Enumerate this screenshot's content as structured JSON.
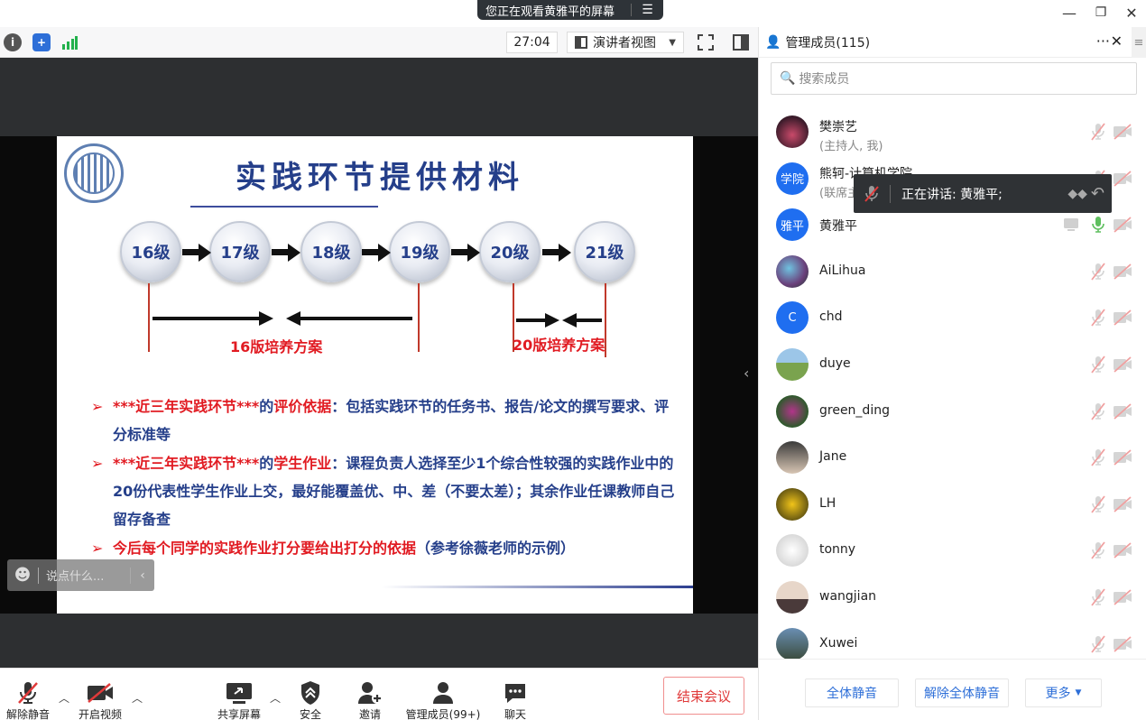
{
  "window": {
    "share_banner": "您正在观看黄雅平的屏幕",
    "banner_menu": "☰",
    "minimize": "—",
    "restore": "❐",
    "close": "✕"
  },
  "toolbar": {
    "timer": "27:04",
    "view_mode": "演讲者视图"
  },
  "slide": {
    "title": "实践环节提供材料",
    "grades": [
      "16级",
      "17级",
      "18级",
      "19级",
      "20级",
      "21级"
    ],
    "plan16": "16版培养方案",
    "plan20": "20版培养方案",
    "bullet1_red": "***近三年实践环节***",
    "bullet1_black": "的",
    "bullet1_red2": "评价依据",
    "bullet1_rest": "：包括实践环节的任务书、报告/论文的撰写要求、评分标准等",
    "bullet2_red": "***近三年实践环节***",
    "bullet2_black": "的",
    "bullet2_red2": "学生作业",
    "bullet2_rest": "：课程负责人选择至少1个综合性较强的实践作业中的20份代表性学生作业上交，最好能覆盖优、中、差（不要太差）；其余作业任课教师自己留存备查",
    "bullet3_red": "今后每个同学的实践作业打分要给出打分的依据",
    "bullet3_rest": "（参考徐薇老师的示例）"
  },
  "chat": {
    "placeholder": "说点什么..."
  },
  "bottom": {
    "unmute": "解除静音",
    "video": "开启视频",
    "share": "共享屏幕",
    "security": "安全",
    "invite": "邀请",
    "manage": "管理成员(99+)",
    "chat": "聊天",
    "end": "结束会议"
  },
  "panel": {
    "title": "管理成员(115)",
    "more": "···",
    "close": "✕",
    "search_placeholder": "搜索成员",
    "speaking": "正在讲话: 黄雅平;",
    "members": [
      {
        "name": "樊崇艺",
        "sub": "(主持人, 我)"
      },
      {
        "name": "熊轲-计算机学院",
        "sub": "(联席主",
        "avatar_text": "学院"
      },
      {
        "name": "黄雅平",
        "avatar_text": "雅平"
      },
      {
        "name": "AiLihua"
      },
      {
        "name": "chd",
        "avatar_text": "C"
      },
      {
        "name": "duye"
      },
      {
        "name": "green_ding"
      },
      {
        "name": "Jane"
      },
      {
        "name": "LH"
      },
      {
        "name": "tonny"
      },
      {
        "name": "wangjian"
      },
      {
        "name": "Xuwei"
      }
    ],
    "mute_all": "全体静音",
    "unmute_all": "解除全体静音",
    "more_menu": "更多"
  },
  "colors": {
    "accent_blue": "#2e6fd8",
    "avatar_blue": "#1f6ef0",
    "end_red": "#e03a3a",
    "slide_blue": "#253f8a",
    "slide_red": "#e11b22"
  }
}
